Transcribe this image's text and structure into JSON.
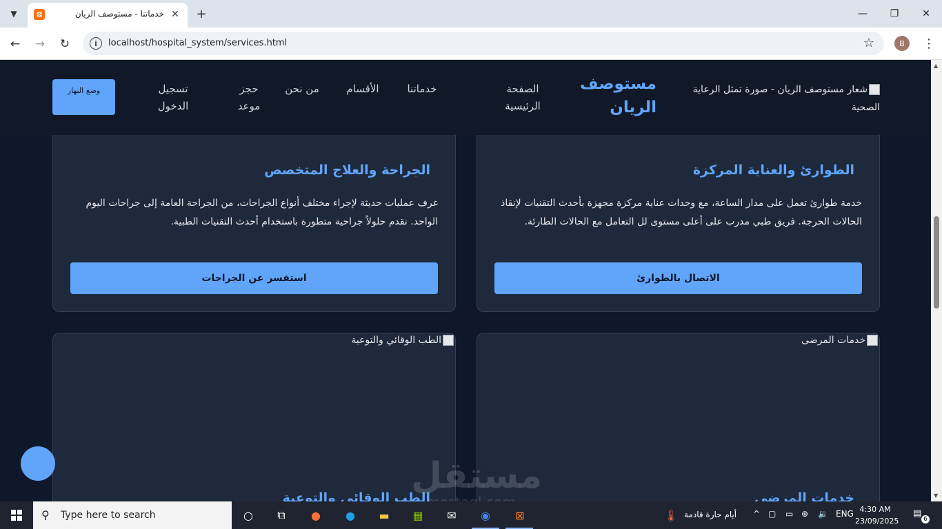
{
  "browser": {
    "tab_title": "خدماتنا - مستوصف الريان",
    "tab_favicon": "⊠",
    "url": "localhost/hospital_system/services.html",
    "profile_initial": "B",
    "icons": {
      "back": "back-arrow-icon",
      "forward": "forward-arrow-icon",
      "reload": "reload-icon",
      "star": "bookmark-star-icon"
    }
  },
  "header": {
    "logo_alt": "شعار مستوصف الريان - صورة تمثل الرعاية الصحية",
    "brand": "مستوصف الريان",
    "nav": {
      "home": "الصفحة الرئيسية",
      "services": "خدماتنا",
      "departments": "الأقسام",
      "about": "من نحن",
      "booking": "حجز موعد",
      "login": "تسجيل الدخول"
    },
    "theme_toggle": "وضع النهار"
  },
  "cards": [
    {
      "title": "الطوارئ والعناية المركزة",
      "text": "خدمة طوارئ تعمل على مدار الساعة، مع وحدات عناية مركزة مجهزة بأحدث التقنيات لإنقاذ الحالات الحرجة. فريق طبي مدرب على أعلى مستوى لل التعامل مع الحالات الطارئة.",
      "button": "الاتصال بالطوارئ"
    },
    {
      "title": "الجراحة والعلاج المتخصص",
      "text": "غرف عمليات حديثة لإجراء مختلف أنواع الجراحات، من الجراحة العامة إلى جراحات اليوم الواحد. نقدم حلولاً جراحية متطورة باستخدام أحدث التقنيات الطبية.",
      "button": "استفسر عن الجراحات"
    },
    {
      "image_alt": "خدمات المرضى",
      "title_partial": "خدمات المرضى"
    },
    {
      "image_alt": "الطب الوقائي والتوعية",
      "title_partial": "الطب الوقائي والتوعية"
    }
  ],
  "watermark": {
    "main": "مستقل",
    "sub": "mostaql.com"
  },
  "taskbar": {
    "search_placeholder": "Type here to search",
    "weather": "أيام حارة قادمة",
    "language": "ENG",
    "time": "4:30 AM",
    "date": "23/09/2025",
    "notifications": "6"
  },
  "colors": {
    "accent": "#60a5fa",
    "page_bg": "#0f172a",
    "card_bg": "#1e293b",
    "header_bg": "#111827"
  }
}
